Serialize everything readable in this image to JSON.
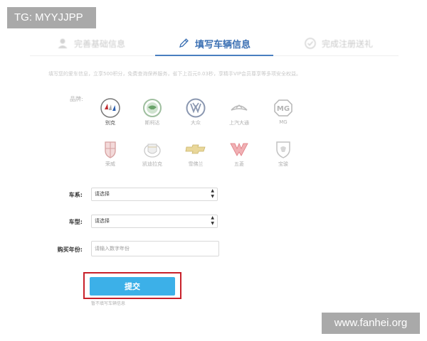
{
  "watermarks": {
    "top": "TG: MYYJJPP",
    "bottom": "www.fanhei.org"
  },
  "steps": [
    {
      "label": "完善基础信息",
      "state": "done"
    },
    {
      "label": "填写车辆信息",
      "state": "active"
    },
    {
      "label": "完成注册送礼",
      "state": "pending"
    }
  ],
  "notice": "填写您的爱车信息，立享500积分，免费查询保养服务，省下上百元0.03秒，享精手VIP会员尊享等多项安全权益。",
  "brand_label": "品牌:",
  "brands": [
    {
      "name": "别克",
      "selected": true
    },
    {
      "name": "斯柯达",
      "selected": false
    },
    {
      "name": "大众",
      "selected": false
    },
    {
      "name": "上汽大通",
      "selected": false
    },
    {
      "name": "MG",
      "selected": false
    },
    {
      "name": "荣威",
      "selected": false
    },
    {
      "name": "凯迪拉克",
      "selected": false
    },
    {
      "name": "雪佛兰",
      "selected": false
    },
    {
      "name": "五菱",
      "selected": false
    },
    {
      "name": "宝骏",
      "selected": false
    }
  ],
  "form": {
    "series": {
      "label": "车系:",
      "value": "请选择"
    },
    "model": {
      "label": "车型:",
      "value": "请选择"
    },
    "year": {
      "label": "购买年份:",
      "placeholder": "请输入数字年份"
    }
  },
  "submit_label": "提交",
  "skip_label": "暂不填写车辆信息",
  "colors": {
    "accent": "#3cb0e8",
    "step_active": "#3a6fb3",
    "highlight": "#c8202a"
  }
}
